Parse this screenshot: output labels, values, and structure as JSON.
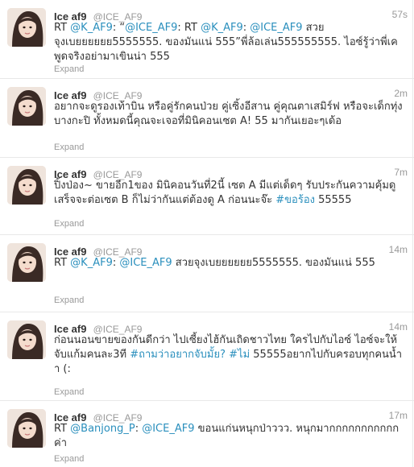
{
  "tweets": [
    {
      "fullname": "Ice af9",
      "username": "@ICE_AF9",
      "time": "57s",
      "segments": [
        {
          "t": "RT ",
          "link": false
        },
        {
          "t": "@K_AF9",
          "link": true
        },
        {
          "t": ": “",
          "link": false
        },
        {
          "t": "@ICE_AF9",
          "link": true
        },
        {
          "t": ": RT ",
          "link": false
        },
        {
          "t": "@K_AF9",
          "link": true
        },
        {
          "t": ": ",
          "link": false
        },
        {
          "t": "@ICE_AF9",
          "link": true
        },
        {
          "t": " สวยจุงเบยยยยยย5555555. ของมันแน่ 555”พี่ล้อเล่น555555555. ไอซ์รู้ว่าพี่เคพูดจริงอย่ามาเขินน่า 555",
          "link": false
        }
      ],
      "expand": "Expand"
    },
    {
      "fullname": "Ice af9",
      "username": "@ICE_AF9",
      "time": "2m",
      "segments": [
        {
          "t": "อยากจะดูรองเท้าบิน หรือคู่รักคนป่วย คู่เซิ้งอีสาน คู่คุณตาเสมิร์ฟ หรือจะเด็กทุ่งบางกะปิ ทั้งหมดนี้คุณจะเจอที่มินิคอนเซต A! 55 มากันเยอะๆเด้อ",
          "link": false
        }
      ],
      "expand": "Expand"
    },
    {
      "fullname": "Ice af9",
      "username": "@ICE_AF9",
      "time": "7m",
      "segments": [
        {
          "t": "ปิ้งป่อง~ ขายอีก1ของ มินิคอนวันที่2นี้ เซต A มีแต่เด็ดๆ รับประกันความคุ้มดูเสร็จจะต่อเซต B ก็ไม่ว่ากันแต่ต้องดู A ก่อนนะจ๊ะ  ",
          "link": false
        },
        {
          "t": "#ขอร้อง",
          "link": true
        },
        {
          "t": " 55555",
          "link": false
        }
      ],
      "expand": "Expand"
    },
    {
      "fullname": "Ice af9",
      "username": "@ICE_AF9",
      "time": "14m",
      "segments": [
        {
          "t": "RT ",
          "link": false
        },
        {
          "t": "@K_AF9",
          "link": true
        },
        {
          "t": ": ",
          "link": false
        },
        {
          "t": "@ICE_AF9",
          "link": true
        },
        {
          "t": " สวยจุงเบยยยยยย5555555. ของมันแน่ 555",
          "link": false
        }
      ],
      "expand": "Expand"
    },
    {
      "fullname": "Ice af9",
      "username": "@ICE_AF9",
      "time": "14m",
      "segments": [
        {
          "t": "ก่อนนอนขายของกันดีกว่า ไปเซี้ยงไฮ้กันเถิดชาวไทย ใครไปกับไอซ์ ไอซ์จะให้จับแก้มคนละ3ที ",
          "link": false
        },
        {
          "t": "#ถามว่าอยากจับมั้ย?",
          "link": true
        },
        {
          "t": " ",
          "link": false
        },
        {
          "t": "#ไม่",
          "link": true
        },
        {
          "t": " 55555อยากไปกับครอบทุกคนน้ำา (:",
          "link": false
        }
      ],
      "expand": "Expand"
    },
    {
      "fullname": "Ice af9",
      "username": "@ICE_AF9",
      "time": "17m",
      "segments": [
        {
          "t": "RT ",
          "link": false
        },
        {
          "t": "@Banjong_P",
          "link": true
        },
        {
          "t": ": ",
          "link": false
        },
        {
          "t": "@ICE_AF9",
          "link": true
        },
        {
          "t": " ขอนแก่นหนุกป่าววว. หนุกมากกกกกกกกกกกค่า",
          "link": false
        }
      ],
      "expand": "Expand"
    }
  ]
}
